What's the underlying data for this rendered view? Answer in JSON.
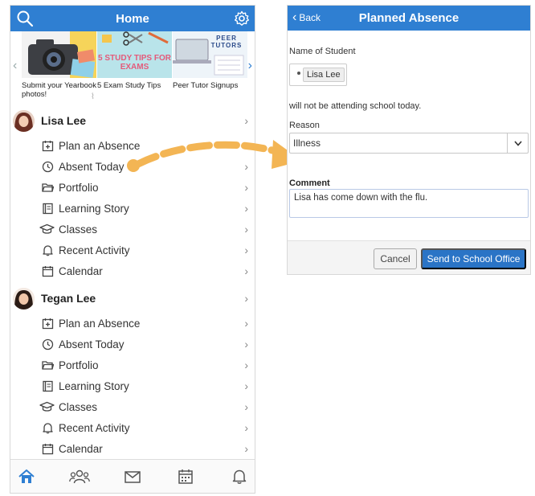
{
  "colors": {
    "header_blue": "#2f7fd2",
    "button_blue": "#2a74c6",
    "arrow_orange": "#f3b554"
  },
  "home": {
    "title": "Home",
    "header_left_icon": "search-icon",
    "header_right_icon": "gear-icon",
    "carousel": {
      "tiles": [
        {
          "caption": "Submit your Yearbook photos!",
          "icon": "camera-icon"
        },
        {
          "caption": "5 Exam Study Tips",
          "image_text": "5 STUDY TIPS FOR EXAMS"
        },
        {
          "caption": "Peer Tutor Signups",
          "image_text": "PEER TUTORS"
        }
      ]
    },
    "students": [
      {
        "name": "Lisa Lee",
        "menu": [
          {
            "label": "Plan an Absence",
            "icon": "calendar-plus-icon"
          },
          {
            "label": "Absent Today",
            "icon": "clock-icon"
          },
          {
            "label": "Portfolio",
            "icon": "folder-icon"
          },
          {
            "label": "Learning Story",
            "icon": "book-icon"
          },
          {
            "label": "Classes",
            "icon": "graduation-cap-icon"
          },
          {
            "label": "Recent Activity",
            "icon": "bell-icon"
          },
          {
            "label": "Calendar",
            "icon": "calendar-icon"
          }
        ]
      },
      {
        "name": "Tegan Lee",
        "menu": [
          {
            "label": "Plan an Absence",
            "icon": "calendar-plus-icon"
          },
          {
            "label": "Absent Today",
            "icon": "clock-icon"
          },
          {
            "label": "Portfolio",
            "icon": "folder-icon"
          },
          {
            "label": "Learning Story",
            "icon": "book-icon"
          },
          {
            "label": "Classes",
            "icon": "graduation-cap-icon"
          },
          {
            "label": "Recent Activity",
            "icon": "bell-icon"
          },
          {
            "label": "Calendar",
            "icon": "calendar-icon"
          }
        ]
      }
    ],
    "tabbar": [
      "home-icon",
      "people-icon",
      "mail-icon",
      "calendar-grid-icon",
      "bell-icon"
    ]
  },
  "absence": {
    "back_label": "Back",
    "title": "Planned Absence",
    "name_label": "Name of Student",
    "student_chip": "Lisa Lee",
    "statement": "will not be attending school today.",
    "reason_label": "Reason",
    "reason_value": "Illness",
    "comment_label": "Comment",
    "comment_value": "Lisa has come down with the flu.",
    "cancel_label": "Cancel",
    "send_label": "Send to School Office"
  }
}
